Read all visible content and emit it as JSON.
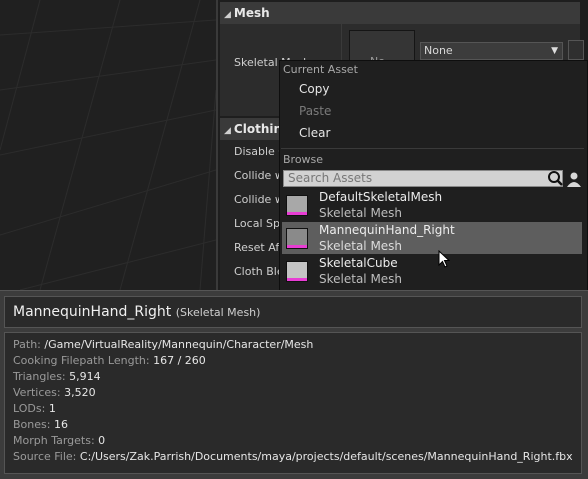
{
  "details": {
    "mesh_category": "Mesh",
    "skeletal_mesh_label": "Skeletal Mesh",
    "thumbnail_text": "No",
    "combo_value": "None",
    "clothing_category": "Clothing",
    "clothing_props": [
      "Disable C",
      "Collide w",
      "Collide w",
      "Local Spa",
      "Reset Aft",
      "Cloth Ble"
    ]
  },
  "menu": {
    "current_asset_header": "Current Asset",
    "copy": "Copy",
    "paste": "Paste",
    "clear": "Clear",
    "browse_header": "Browse",
    "search_placeholder": "Search Assets",
    "assets": [
      {
        "name": "DefaultSkeletalMesh",
        "type": "Skeletal Mesh"
      },
      {
        "name": "MannequinHand_Right",
        "type": "Skeletal Mesh",
        "selected": true
      },
      {
        "name": "SkeletalCube",
        "type": "Skeletal Mesh"
      }
    ]
  },
  "tooltip": {
    "name": "MannequinHand_Right",
    "type_label": "(Skeletal Mesh)",
    "details": [
      {
        "label": "Path:",
        "value": "/Game/VirtualReality/Mannequin/Character/Mesh"
      },
      {
        "label": "Cooking Filepath Length:",
        "value": "167 / 260"
      },
      {
        "label": "Triangles:",
        "value": "5,914"
      },
      {
        "label": "Vertices:",
        "value": "3,520"
      },
      {
        "label": "LODs:",
        "value": "1"
      },
      {
        "label": "Bones:",
        "value": "16"
      },
      {
        "label": "Morph Targets:",
        "value": "0"
      },
      {
        "label": "Source File:",
        "value": "C:/Users/Zak.Parrish/Documents/maya/projects/default/scenes/MannequinHand_Right.fbx"
      }
    ]
  },
  "colors": {
    "selection": "#5e5e5e",
    "thumb_accent": "#e83dd4",
    "panel": "#1e1e1e"
  }
}
